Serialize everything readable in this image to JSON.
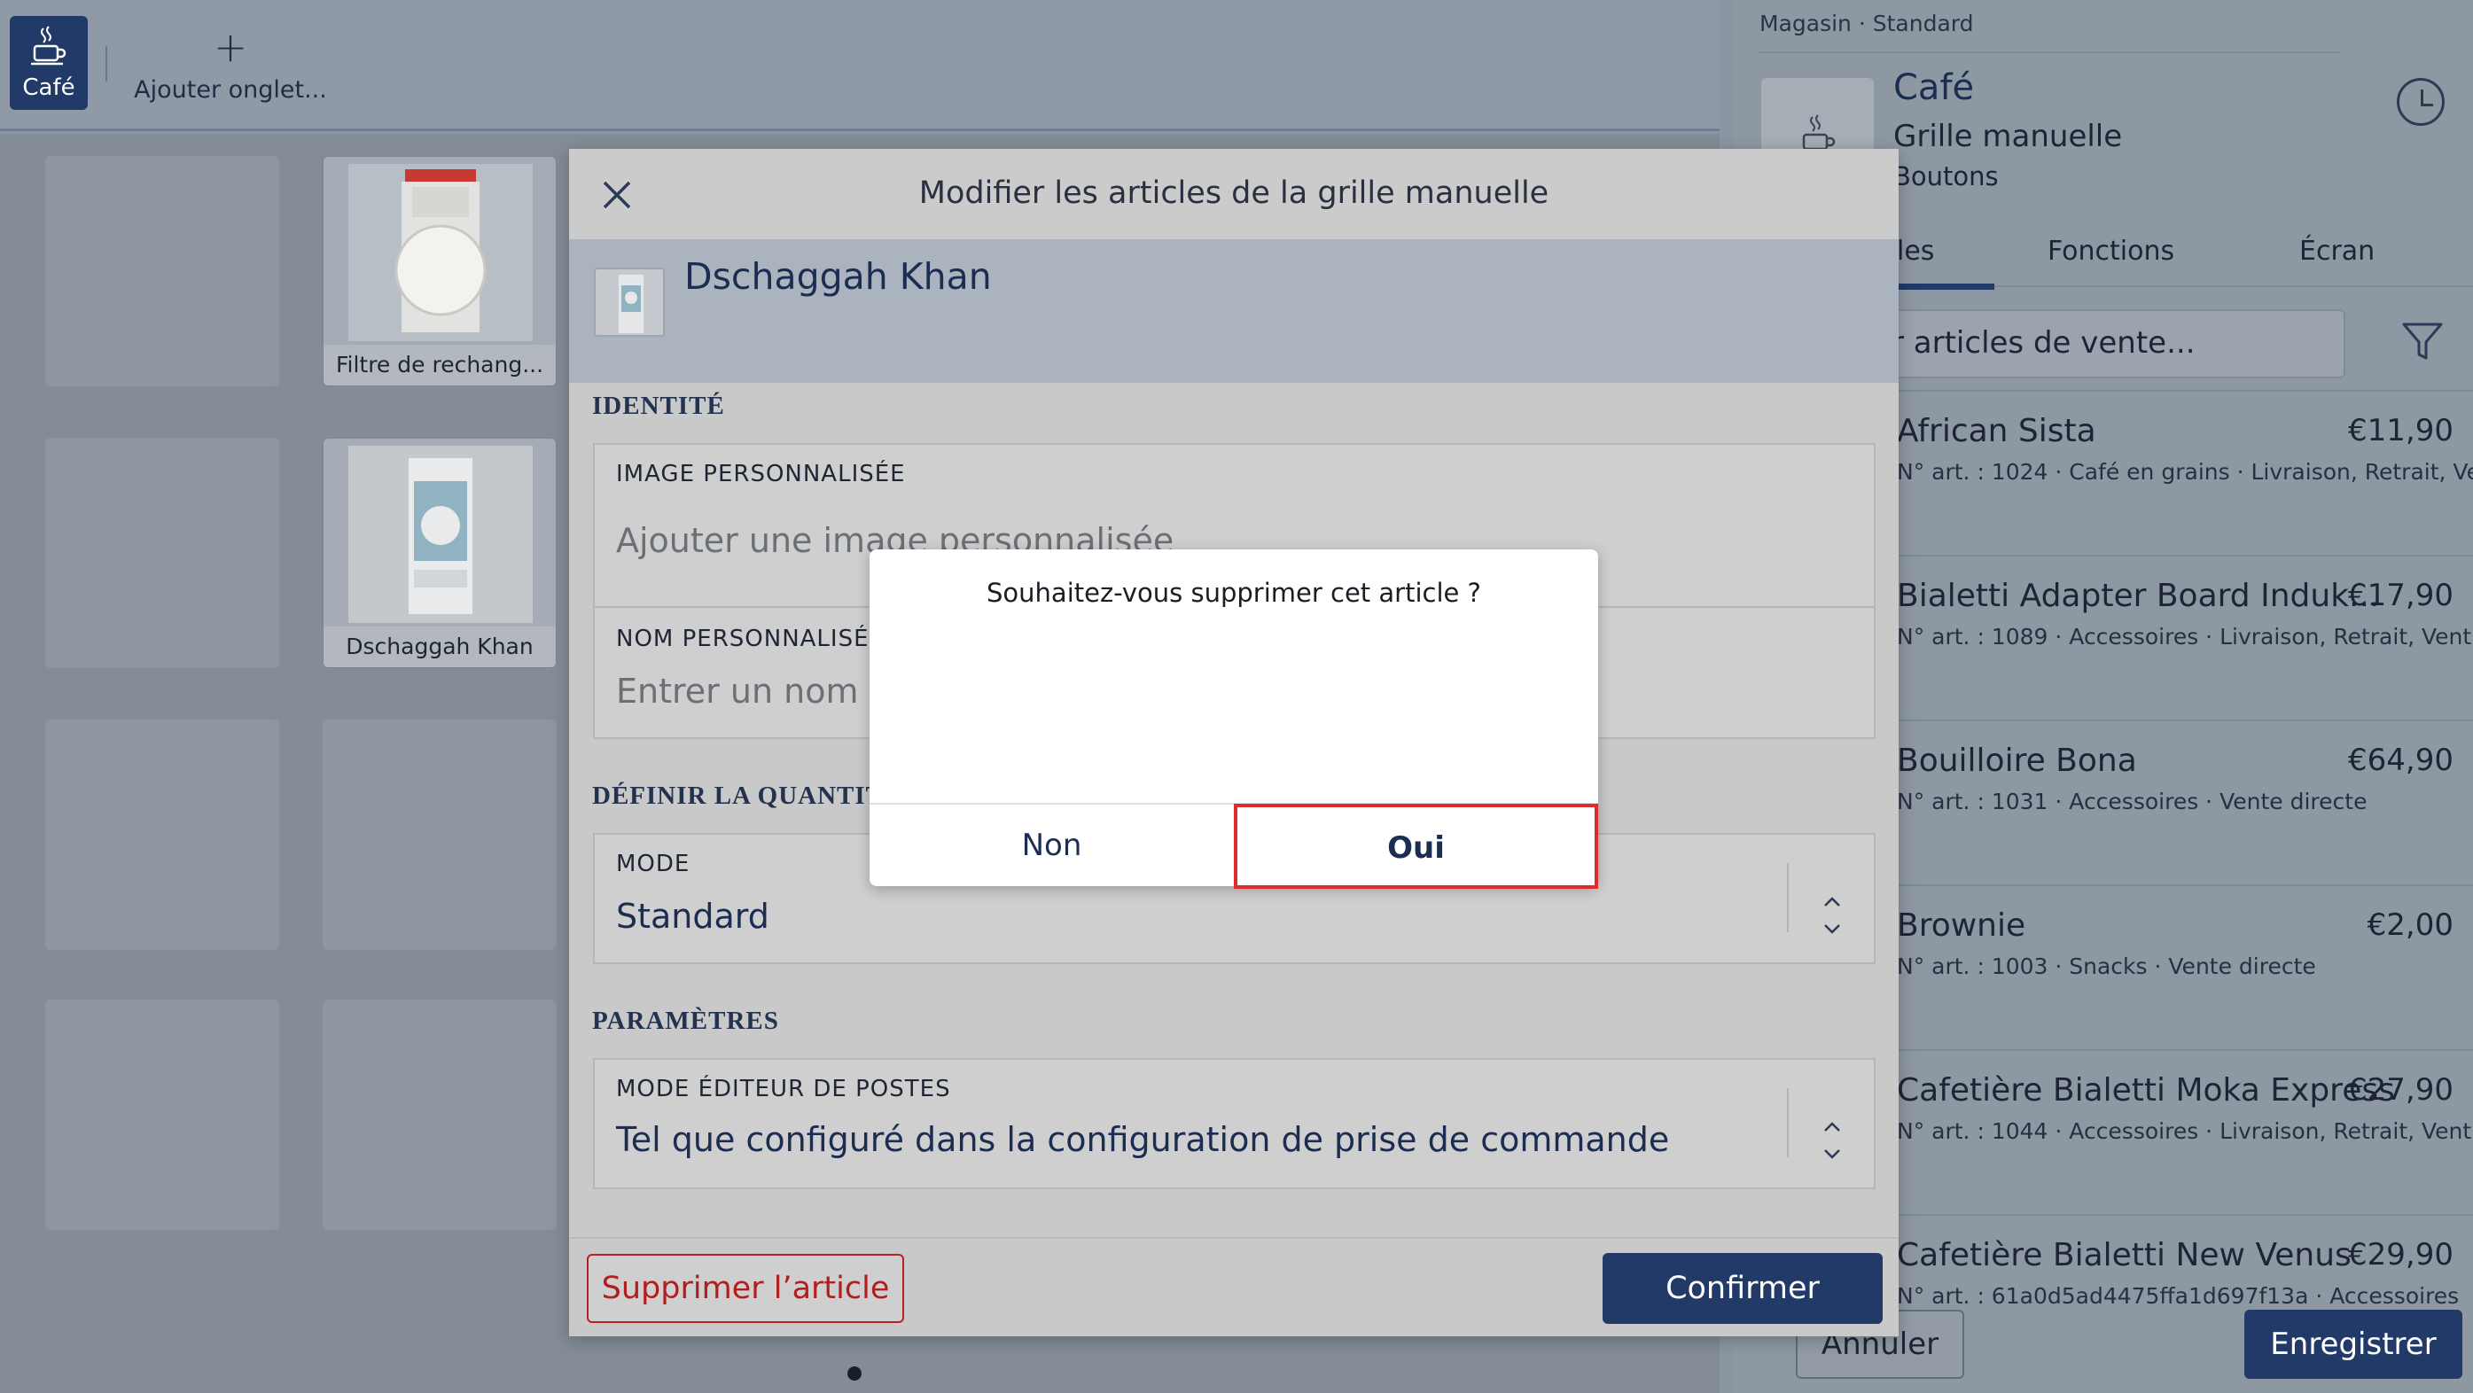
{
  "topbar": {
    "active_tab_label": "Café",
    "add_tab_label": "Ajouter onglet..."
  },
  "grid": {
    "items": [
      {
        "label": "Filtre de rechang..."
      },
      {
        "label": "Dschaggah Khan"
      }
    ]
  },
  "right_panel": {
    "breadcrumb": "Magasin · Standard",
    "title": "Café",
    "subtitle": "Grille manuelle",
    "subtitle2": "Boutons",
    "tabs": [
      "les",
      "Fonctions",
      "Écran"
    ],
    "search_placeholder": "r articles de vente...",
    "items": [
      {
        "name": "African Sista",
        "price": "€11,90",
        "meta": "N° art. : 1024 · Café en grains · Livraison, Retrait, Ve..."
      },
      {
        "name": "Bialetti Adapter Board Induk...",
        "price": "€17,90",
        "meta": "N° art. : 1089 · Accessoires · Livraison, Retrait, Vent..."
      },
      {
        "name": "Bouilloire Bona",
        "price": "€64,90",
        "meta": "N° art. : 1031 · Accessoires · Vente directe"
      },
      {
        "name": "Brownie",
        "price": "€2,00",
        "meta": "N° art. : 1003 · Snacks · Vente directe"
      },
      {
        "name": "Cafetière Bialetti Moka Express",
        "price": "€27,90",
        "meta": "N° art. : 1044 · Accessoires · Livraison, Retrait, Vent..."
      },
      {
        "name": "Cafetière Bialetti New Venus",
        "price": "€29,90",
        "meta": "N° art. : 61a0d5ad4475ffa1d697f13a · Accessoires"
      }
    ],
    "cancel_label": "Annuler",
    "save_label": "Enregistrer"
  },
  "dialog": {
    "title": "Modifier les articles de la grille manuelle",
    "article_name": "Dschaggah Khan",
    "section_identity": "IDENTITÉ",
    "custom_image_label": "IMAGE PERSONNALISÉE",
    "custom_image_placeholder": "Ajouter une image personnalisée",
    "custom_name_label": "NOM PERSONNALISÉ",
    "custom_name_placeholder": "Entrer un nom personnalisé",
    "section_quantity": "DÉFINIR LA QUANTITÉ",
    "mode_label": "MODE",
    "mode_value": "Standard",
    "section_params": "PARAMÈTRES",
    "post_editor_label": "MODE ÉDITEUR DE POSTES",
    "post_editor_value": "Tel que configuré dans la configuration de prise de commande",
    "delete_label": "Supprimer l’article",
    "confirm_label": "Confirmer"
  },
  "confirm_popup": {
    "message": "Souhaitez-vous supprimer cet article ?",
    "no_label": "Non",
    "yes_label": "Oui"
  },
  "colors": {
    "brand": "#213a68",
    "danger": "#b01e1e",
    "highlight": "#e02b2b"
  }
}
